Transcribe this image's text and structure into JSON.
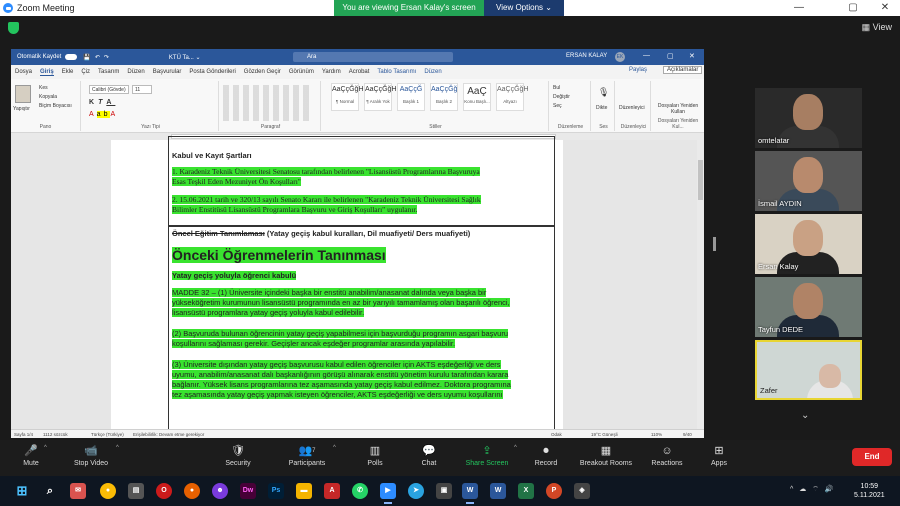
{
  "zoom": {
    "app_title": "Zoom Meeting",
    "banner_text": "You are viewing Ersan Kalay's screen",
    "view_options": "View Options ⌄",
    "view_label": "View"
  },
  "word": {
    "autosave": "Otomatik Kaydet",
    "file_name": "KTÜ Ta... ⌄",
    "search_placeholder": "Ara",
    "user_name": "ERSAN KALAY",
    "user_initials": "EK",
    "tabs": [
      "Dosya",
      "Giriş",
      "Ekle",
      "Çiz",
      "Tasarım",
      "Düzen",
      "Başvurular",
      "Posta Gönderileri",
      "Gözden Geçir",
      "Görünüm",
      "Yardım",
      "Acrobat",
      "Tablo Tasarımı",
      "Düzen"
    ],
    "share": "Paylaş",
    "comments": "Açıklamalar",
    "ribbon": {
      "paste": "Yapıştır",
      "cut": "Kes",
      "copy": "Kopyala",
      "format_painter": "Biçim Boyacısı",
      "clipboard": "Pano",
      "font_name": "Calibri (Gövde)",
      "font_size": "11",
      "font_group": "Yazı Tipi",
      "paragraph_group": "Paragraf",
      "styles_group": "Stiller",
      "styles": [
        {
          "sample": "AaÇçĞğHı",
          "name": "¶ Normal"
        },
        {
          "sample": "AaÇçĞğHı",
          "name": "¶ Aralık Yok"
        },
        {
          "sample": "AaÇçĞ",
          "name": "Başlık 1"
        },
        {
          "sample": "AaÇçĞğ",
          "name": "Başlık 2"
        },
        {
          "sample": "AaÇ",
          "name": "Konu Başlı..."
        },
        {
          "sample": "AaÇçĞğH",
          "name": "Altyazı"
        }
      ],
      "find": "Bul",
      "replace": "Değiştir",
      "select": "Seç",
      "editing_group": "Düzenleme",
      "dictate": "Dikte",
      "voice_group": "Ses",
      "editor": "Düzenleyici",
      "editor_group": "Düzenleyici",
      "reuse_files": "Dosyaları Yeniden Kullan",
      "reuse_group": "Dosyaları Yeniden Kul..."
    },
    "document": {
      "heading1": "Kabul ve Kayıt Şartları",
      "p1_l1": "1. Karadeniz Teknik Üniversitesi Senatosu tarafından belirlenen \"Lisansüstü Programlarına Başvuruya",
      "p1_l2": "Esas Teşkil Eden Mezuniyet Ön Koşulları\"",
      "p2_l1": "2. 15.06.2021 tarih ve 320/13 sayılı Senato Kararı ile belirlenen \"Karadeniz Teknik Üniversitesi Sağlık",
      "p2_l2": "Bilimler Enstitüsü Lisansüstü Programlara Başvuru ve Giriş Koşulları\" uygulanır.",
      "heading2_strike": "Öncel Eğitim Tanımlaması",
      "heading2_rest": " (Yatay geçiş kabul kuralları, Dil muafiyeti/ Ders muafiyeti)",
      "big_title": "Önceki Öğrenmelerin Tanınması",
      "sub_title": "Yatay geçiş yoluyla öğrenci kabulü",
      "m_l1": "MADDE 32 – (1) Üniversite içindeki başka bir enstitü anabilim/anasanat dalında veya başka bir",
      "m_l2": "yükseköğretim kurumunun lisansüstü programında en az bir yarıyılı tamamlamış olan başarılı öğrenci,",
      "m_l3": "lisansüstü programlara yatay geçiş yoluyla kabul edilebilir.",
      "m2_l1": "(2) Başvuruda bulunan öğrencinin yatay geçiş yapabilmesi için başvurduğu programın asgari başvuru",
      "m2_l2": "koşullarını sağlaması gerekir. Geçişler ancak eşdeğer programlar arasında yapılabilir.",
      "m3_l1": "(3) Üniversite dışından yatay geçiş başvurusu kabul edilen öğrenciler için AKTS eşdeğerliği ve ders",
      "m3_l2": "uyumu, anabilim/anasanat dalı başkanlığının görüşü alınarak enstitü yönetim kurulu tarafından karara",
      "m3_l3": "bağlanır. Yüksek lisans programlarına tez aşamasında yatay geçiş kabul edilmez. Doktora programına",
      "m3_l4": "tez aşamasında yatay geçiş yapmak isteyen öğrenciler, AKTS eşdeğerliği ve ders uyumu koşullarını"
    },
    "status": {
      "page": "Sayfa 1/4",
      "words": "1112 sözcük",
      "lang": "Türkçe (Türkiye)",
      "accessibility": "Erişilebilirlik: Devam etme gerekiyor",
      "focus": "Odak",
      "weather": "19°C  Güneşli",
      "zoom": "110%",
      "pages_right": "9/40"
    }
  },
  "participants": [
    {
      "name": "omtelatar"
    },
    {
      "name": "İsmail AYDIN"
    },
    {
      "name": "Ersan Kalay"
    },
    {
      "name": "Tayfun DEDE"
    },
    {
      "name": "Zafer"
    }
  ],
  "toolbar": {
    "mute": "Mute",
    "stop_video": "Stop Video",
    "security": "Security",
    "participants": "Participants",
    "participants_count": "7",
    "polls": "Polls",
    "chat": "Chat",
    "share_screen": "Share Screen",
    "record": "Record",
    "breakout": "Breakout Rooms",
    "reactions": "Reactions",
    "apps": "Apps",
    "end": "End"
  },
  "taskbar": {
    "time": "10:59",
    "date": "5.11.2021"
  }
}
